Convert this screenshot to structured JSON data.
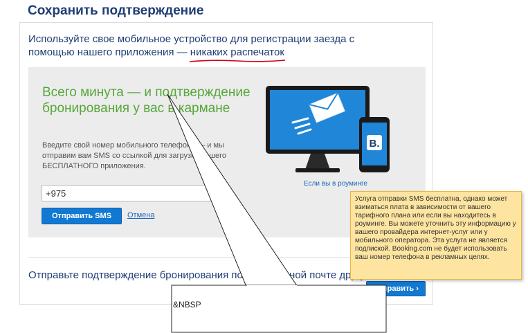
{
  "page": {
    "title": "Сохранить подтверждение"
  },
  "intro": {
    "text_before": "Используйте свое мобильное устройство для регистрации заезда с помощью нашего приложения — ",
    "highlight": "никаких распечаток"
  },
  "sms": {
    "headline": "Всего минута — и подтверждение бронирования у вас в кармане",
    "description": "Введите свой номер мобильного телефона — и мы отправим вам SMS со ссылкой для загрузки нашего БЕСПЛАТНОГО приложения.",
    "phone_value": "+975",
    "send_label": "Отправить SMS",
    "cancel_label": "Отмена",
    "roaming_label": "Если вы в роуминге"
  },
  "email": {
    "text": "Отправьте подтверждение бронирования по электронной почте другу",
    "button_label": "Отправить ›"
  },
  "tooltip": {
    "text": "Услуга отправки SMS бесплатна, однако может взиматься плата в зависимости от вашего тарифного плана или если вы находитесь в роуминге. Вы можете уточнить эту информацию у вашего провайдера интернет-услуг или у мобильного оператора. Эта услуга не является подпиской. Booking.com не будет использовать ваш номер телефона в рекламных целях."
  },
  "callout": {
    "text": "&NBSP"
  },
  "icons": {
    "email": "envelope-icon",
    "brand": "booking-b-icon"
  },
  "colors": {
    "title": "#1f3d75",
    "headline": "#56a73a",
    "button": "#1279d3",
    "tooltip_bg": "#fde4a0",
    "underline": "#d0021b"
  }
}
